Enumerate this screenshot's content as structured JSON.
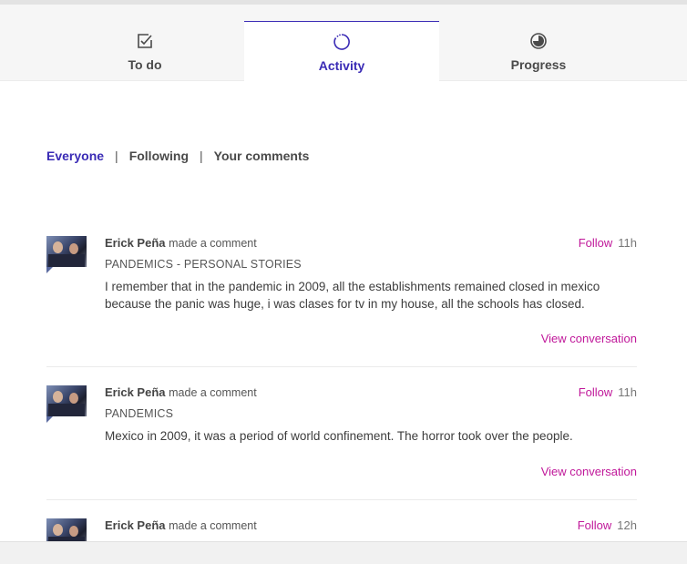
{
  "tabs": [
    {
      "label": "To do",
      "icon": "checkbox-edit-icon"
    },
    {
      "label": "Activity",
      "icon": "activity-spinner-icon"
    },
    {
      "label": "Progress",
      "icon": "progress-ring-icon"
    }
  ],
  "filters": {
    "everyone": "Everyone",
    "following": "Following",
    "your_comments": "Your comments",
    "separator": "|"
  },
  "comments": [
    {
      "author": "Erick Peña",
      "action": "made a comment",
      "follow": "Follow",
      "time": "11h",
      "step": "PANDEMICS - PERSONAL STORIES",
      "text": "I remember that in the pandemic in 2009, all the establishments remained closed in mexico because the panic was huge, i was clases for tv in my house, all the schools has closed.",
      "view": "View conversation"
    },
    {
      "author": "Erick Peña",
      "action": "made a comment",
      "follow": "Follow",
      "time": "11h",
      "step": "PANDEMICS",
      "text": "Mexico in 2009, it was a period of world confinement. The horror took over the people.",
      "view": "View conversation"
    },
    {
      "author": "Erick Peña",
      "action": "made a comment",
      "follow": "Follow",
      "time": "12h"
    }
  ],
  "colors": {
    "accent": "#3a2bb5",
    "link": "#c0189a"
  }
}
